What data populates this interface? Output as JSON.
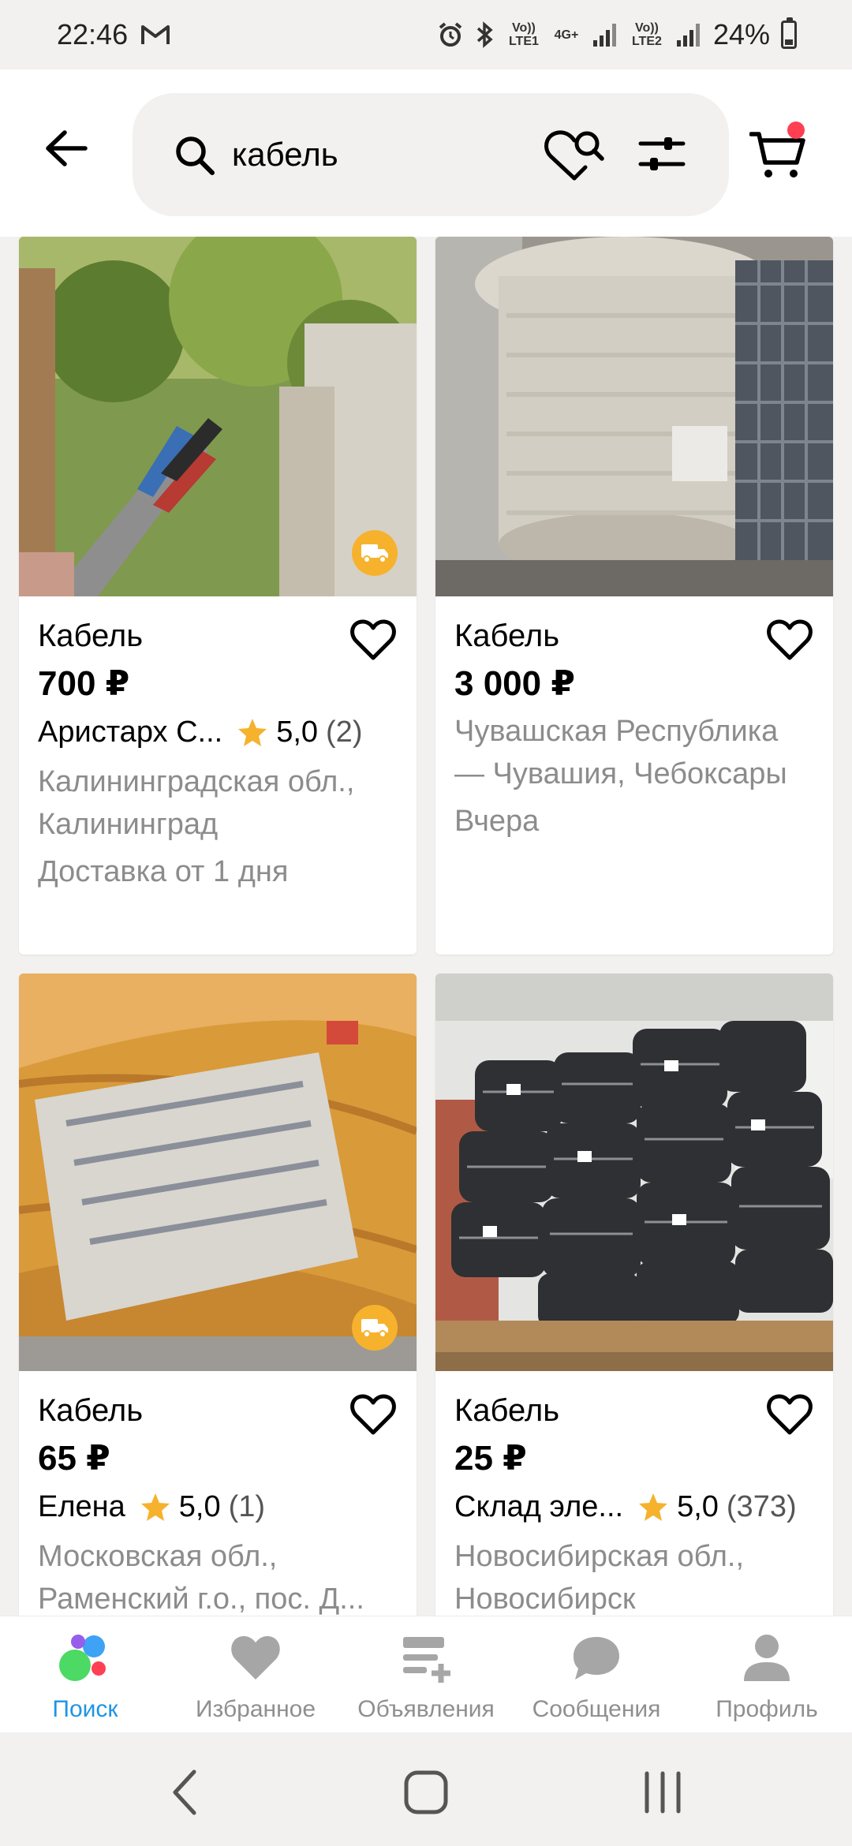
{
  "status_bar": {
    "time": "22:46",
    "sim1": "Vo)) LTE1",
    "network": "4G+",
    "sim2": "Vo)) LTE2",
    "battery": "24%"
  },
  "search": {
    "query": "кабель"
  },
  "listings": [
    {
      "title": "Кабель",
      "price": "700 ₽",
      "seller": "Аристарх С...",
      "rating": "5,0",
      "reviews": "(2)",
      "location_line1": "Калининградская обл.,",
      "location_line2": "Калининград",
      "extra": "Доставка от 1 дня",
      "has_delivery": true
    },
    {
      "title": "Кабель",
      "price": "3 000 ₽",
      "location_line1": "Чувашская Республика",
      "location_line2": "— Чувашия, Чебоксары",
      "extra": "Вчера",
      "has_delivery": false
    },
    {
      "title": "Кабель",
      "price": "65 ₽",
      "seller": "Елена",
      "rating": "5,0",
      "reviews": "(1)",
      "location_line1": "Московская обл.,",
      "location_line2": "Раменский г.о., пос. Д...",
      "has_delivery": true
    },
    {
      "title": "Кабель",
      "price": "25 ₽",
      "seller": "Склад эле...",
      "rating": "5,0",
      "reviews": "(373)",
      "location_line1": "Новосибирская обл.,",
      "location_line2": "Новосибирск",
      "has_delivery": false
    }
  ],
  "bottom_nav": [
    {
      "label": "Поиск",
      "icon": "search-dots-icon",
      "active": true
    },
    {
      "label": "Избранное",
      "icon": "heart-icon",
      "active": false
    },
    {
      "label": "Объявления",
      "icon": "ads-icon",
      "active": false
    },
    {
      "label": "Сообщения",
      "icon": "chat-icon",
      "active": false
    },
    {
      "label": "Профиль",
      "icon": "profile-icon",
      "active": false
    }
  ],
  "colors": {
    "accent_active": "#1e95e4",
    "delivery_badge": "#f6b22d",
    "star": "#f6b22d",
    "cart_dot": "#ff4053"
  }
}
